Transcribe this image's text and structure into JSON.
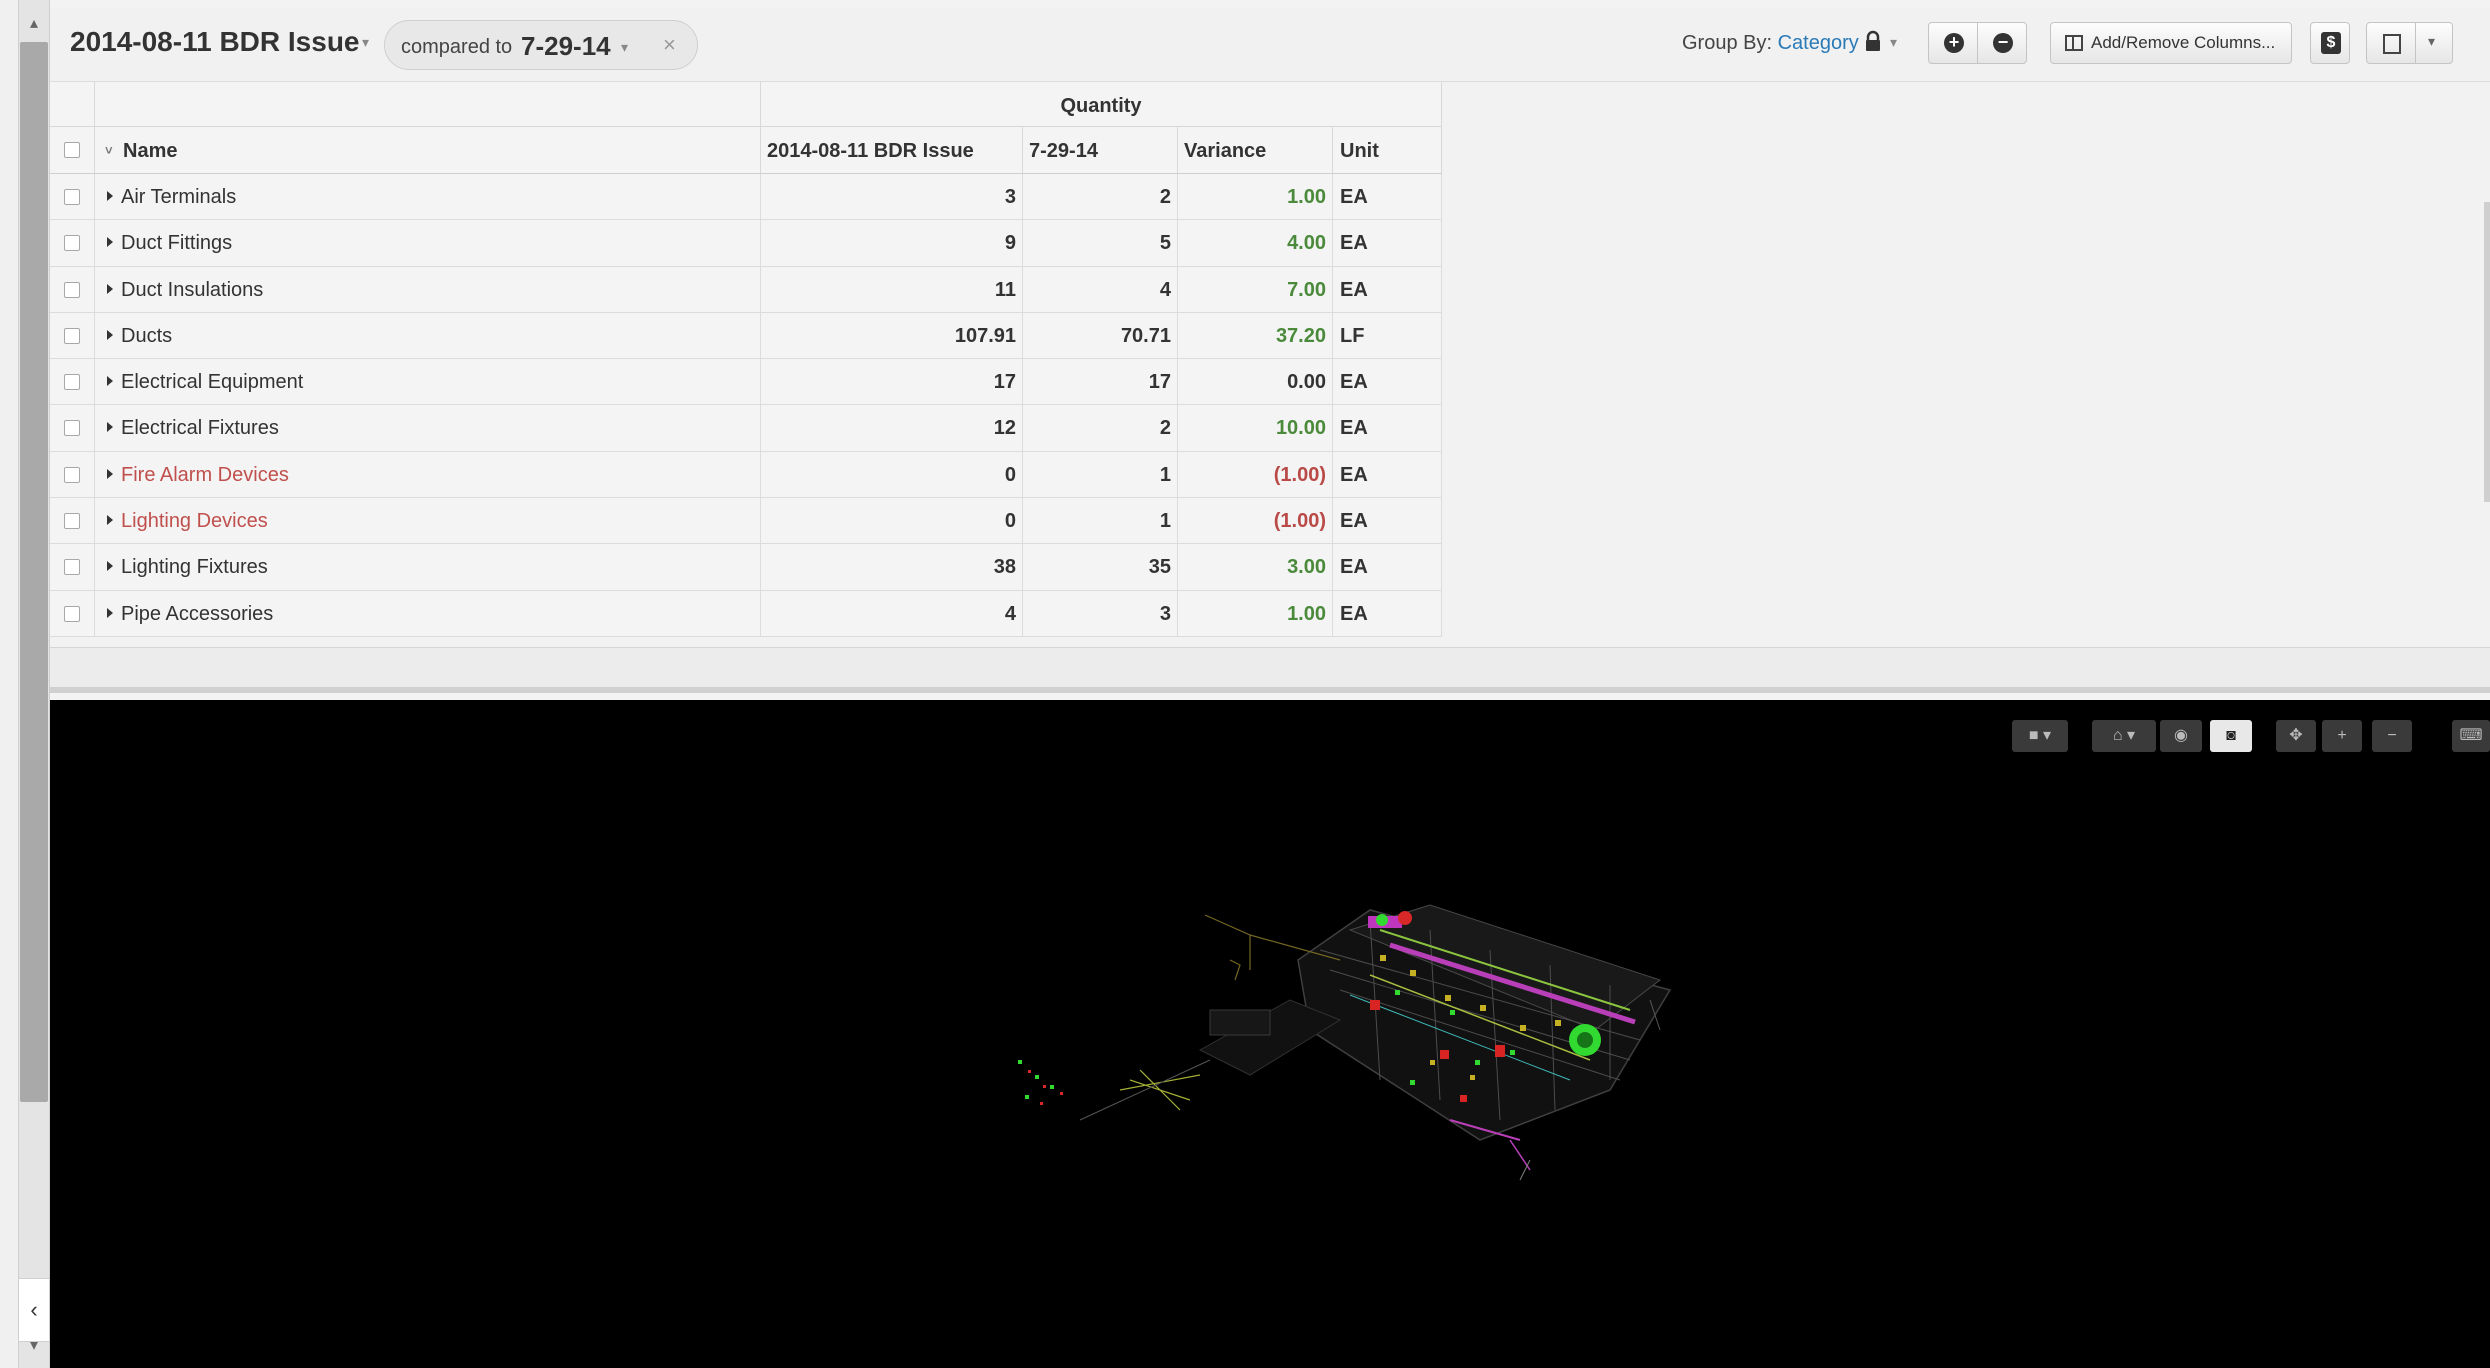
{
  "header": {
    "title": "2014-08-11 BDR Issue",
    "compare_label": "compared to",
    "compare_value": "7-29-14",
    "close_symbol": "×",
    "group_by_label": "Group By:",
    "group_by_value": "Category",
    "columns_button": "Add/Remove Columns...",
    "dollar_symbol": "$"
  },
  "table": {
    "group_header": "Quantity",
    "columns": [
      "Name",
      "2014-08-11 BDR Issue",
      "7-29-14",
      "Variance",
      "Unit"
    ],
    "rows": [
      {
        "name": "Air Terminals",
        "current": "3",
        "previous": "2",
        "variance": "1.00",
        "unit": "EA"
      },
      {
        "name": "Duct Fittings",
        "current": "9",
        "previous": "5",
        "variance": "4.00",
        "unit": "EA"
      },
      {
        "name": "Duct Insulations",
        "current": "11",
        "previous": "4",
        "variance": "7.00",
        "unit": "EA"
      },
      {
        "name": "Ducts",
        "current": "107.91",
        "previous": "70.71",
        "variance": "37.20",
        "unit": "LF"
      },
      {
        "name": "Electrical Equipment",
        "current": "17",
        "previous": "17",
        "variance": "0.00",
        "unit": "EA"
      },
      {
        "name": "Electrical Fixtures",
        "current": "12",
        "previous": "2",
        "variance": "10.00",
        "unit": "EA"
      },
      {
        "name": "Fire Alarm Devices",
        "current": "0",
        "previous": "1",
        "variance": "(1.00)",
        "unit": "EA"
      },
      {
        "name": "Lighting Devices",
        "current": "0",
        "previous": "1",
        "variance": "(1.00)",
        "unit": "EA"
      },
      {
        "name": "Lighting Fixtures",
        "current": "38",
        "previous": "35",
        "variance": "3.00",
        "unit": "EA"
      },
      {
        "name": "Pipe Accessories",
        "current": "4",
        "previous": "3",
        "variance": "1.00",
        "unit": "EA"
      }
    ]
  },
  "colors": {
    "positive": "#4a8a3a",
    "negative": "#b94a48",
    "link": "#2a7ab8"
  },
  "viewer_toolbar": {
    "icons": [
      "cube-icon",
      "home-icon",
      "eye-icon",
      "ghost-icon",
      "move-icon",
      "zoom-in-icon",
      "zoom-out-icon",
      "keyboard-icon"
    ]
  }
}
